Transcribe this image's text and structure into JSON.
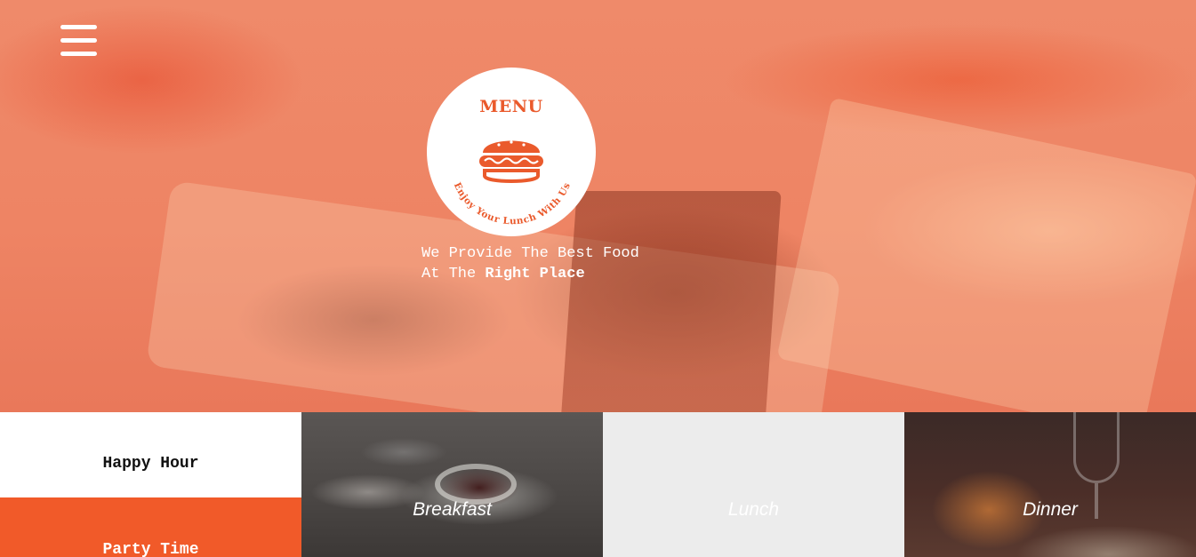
{
  "hero": {
    "menu_toggle_icon": "hamburger-menu-icon",
    "logo": {
      "title": "MENU",
      "icon": "burger-icon",
      "arc_text": "Enjoy Your Lunch With Us",
      "brand_color": "#ea5a2c"
    },
    "tagline": {
      "line1": "We Provide The Best Food",
      "line2_prefix": "At The",
      "line2_bold": "Right Place"
    },
    "overlay_color": "#ee8464"
  },
  "side_menu": {
    "happy_hour": "Happy Hour",
    "party_time": "Party Time",
    "accent_color": "#f15a29"
  },
  "categories": {
    "breakfast": "Breakfast",
    "lunch": "Lunch",
    "dinner": "Dinner"
  }
}
